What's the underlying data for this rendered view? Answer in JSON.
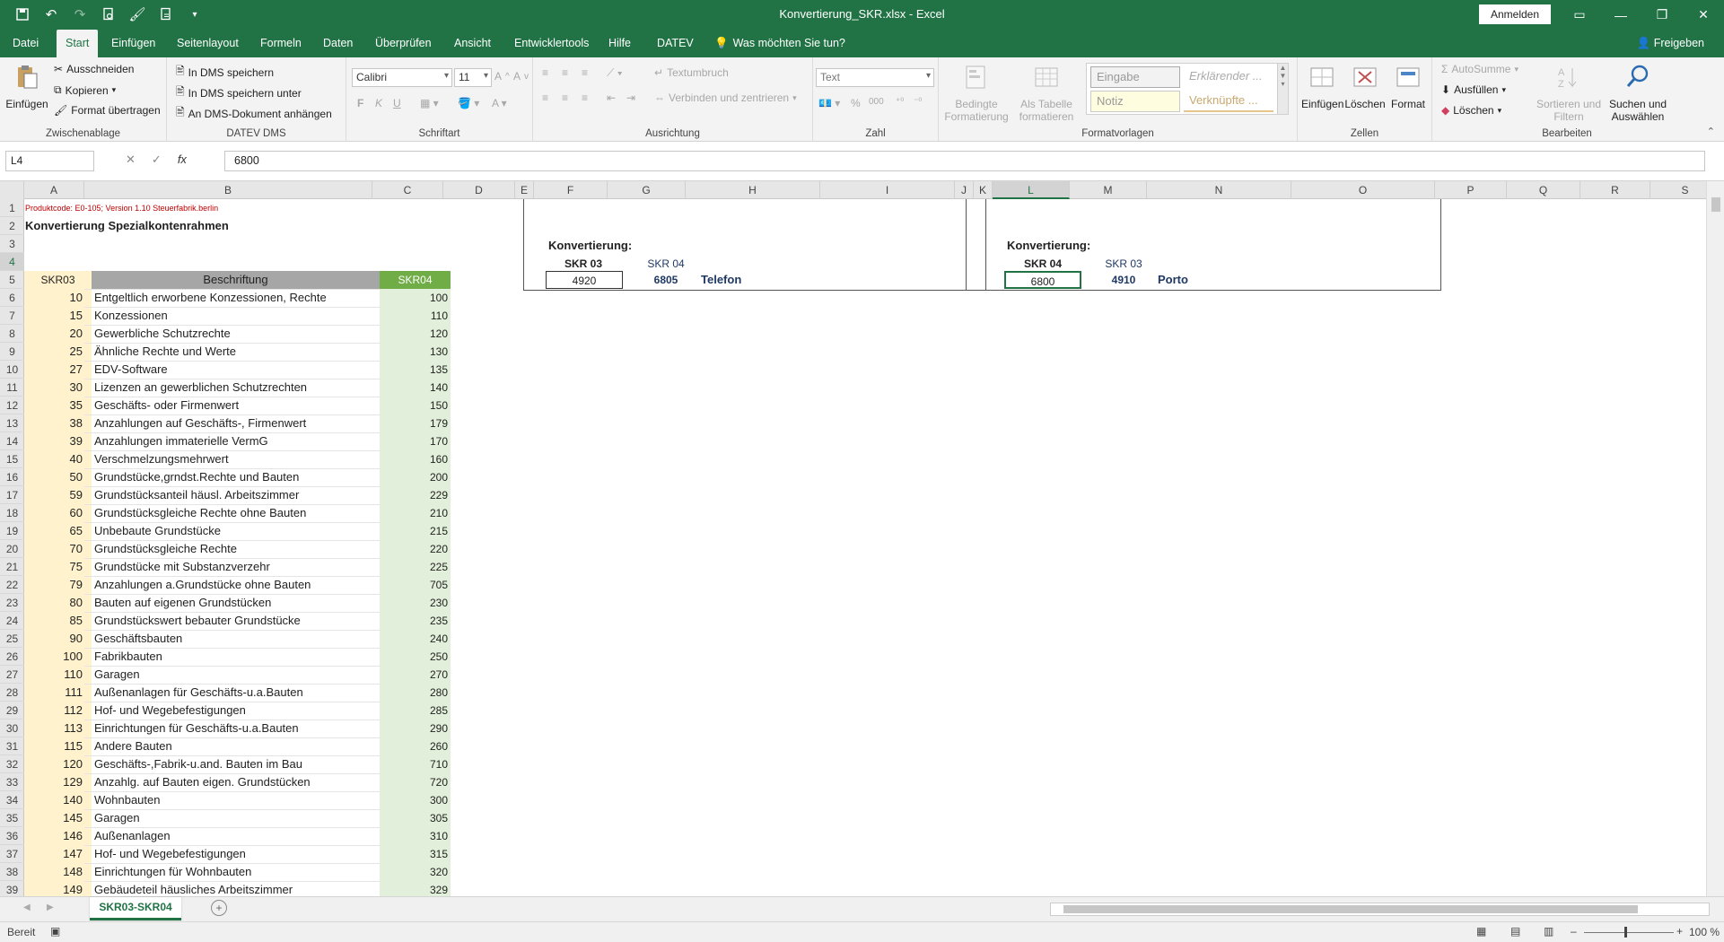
{
  "window": {
    "title": "Konvertierung_SKR.xlsx  -  Excel",
    "signin_label": "Anmelden",
    "share_label": "Freigeben"
  },
  "tabs": [
    "Datei",
    "Start",
    "Einfügen",
    "Seitenlayout",
    "Formeln",
    "Daten",
    "Überprüfen",
    "Ansicht",
    "Entwicklertools",
    "Hilfe",
    "DATEV"
  ],
  "tell_me": "Was möchten Sie tun?",
  "ribbon": {
    "clipboard": {
      "paste": "Einfügen",
      "cut": "Ausschneiden",
      "copy": "Kopieren",
      "format_painter": "Format übertragen",
      "label": "Zwischenablage"
    },
    "datev": {
      "save": "In DMS speichern",
      "save_as": "In DMS speichern unter",
      "attach": "An DMS-Dokument anhängen",
      "label": "DATEV DMS"
    },
    "font": {
      "name": "Calibri",
      "size": "11",
      "bold": "F",
      "italic": "K",
      "underline": "U",
      "label": "Schriftart"
    },
    "alignment": {
      "wrap": "Textumbruch",
      "merge": "Verbinden und zentrieren",
      "label": "Ausrichtung"
    },
    "number": {
      "format": "Text",
      "label": "Zahl"
    },
    "styles": {
      "cond_line1": "Bedingte",
      "cond_line2": "Formatierung",
      "table_line1": "Als Tabelle",
      "table_line2": "formatieren",
      "s1": "Eingabe",
      "s2": "Erklärender ...",
      "s3": "Notiz",
      "s4": "Verknüpfte ...",
      "label": "Formatvorlagen"
    },
    "cells": {
      "insert": "Einfügen",
      "delete": "Löschen",
      "format": "Format",
      "label": "Zellen"
    },
    "editing": {
      "autosum": "AutoSumme",
      "fill": "Ausfüllen",
      "clear": "Löschen",
      "sort_line1": "Sortieren und",
      "sort_line2": "Filtern",
      "find_line1": "Suchen und",
      "find_line2": "Auswählen",
      "label": "Bearbeiten"
    }
  },
  "formula_bar": {
    "name_box": "L4",
    "fx": "fx",
    "formula": "6800"
  },
  "columns": [
    "A",
    "B",
    "C",
    "D",
    "E",
    "F",
    "G",
    "H",
    "I",
    "J",
    "K",
    "L",
    "M",
    "N",
    "O",
    "P",
    "Q",
    "R",
    "S"
  ],
  "selected_column": "L",
  "selected_row": "4",
  "sheet": {
    "product_code": "Produktcode: E0-105; Version 1.10 Steuerfabrik.berlin",
    "title": "Konvertierung Spezialkontenrahmen",
    "headers": {
      "a": "SKR03",
      "b": "Beschriftung",
      "c": "SKR04"
    },
    "conv1": {
      "title": "Konvertierung:",
      "from_label": "SKR 03",
      "to_label": "SKR 04",
      "input": "4920",
      "result": "6805",
      "name": "Telefon"
    },
    "conv2": {
      "title": "Konvertierung:",
      "from_label": "SKR 04",
      "to_label": "SKR 03",
      "input": "6800",
      "result": "4910",
      "name": "Porto"
    },
    "rows": [
      {
        "skr03": "10",
        "text": "Entgeltlich erworbene Konzessionen, Rechte",
        "skr04": "100"
      },
      {
        "skr03": "15",
        "text": "Konzessionen",
        "skr04": "110"
      },
      {
        "skr03": "20",
        "text": "Gewerbliche Schutzrechte",
        "skr04": "120"
      },
      {
        "skr03": "25",
        "text": "Ähnliche Rechte und Werte",
        "skr04": "130"
      },
      {
        "skr03": "27",
        "text": "EDV-Software",
        "skr04": "135"
      },
      {
        "skr03": "30",
        "text": "Lizenzen an gewerblichen Schutzrechten",
        "skr04": "140"
      },
      {
        "skr03": "35",
        "text": "Geschäfts- oder Firmenwert",
        "skr04": "150"
      },
      {
        "skr03": "38",
        "text": "Anzahlungen auf Geschäfts-, Firmenwert",
        "skr04": "179"
      },
      {
        "skr03": "39",
        "text": "Anzahlungen immaterielle VermG",
        "skr04": "170"
      },
      {
        "skr03": "40",
        "text": "Verschmelzungsmehrwert",
        "skr04": "160"
      },
      {
        "skr03": "50",
        "text": "Grundstücke,grndst.Rechte und Bauten",
        "skr04": "200"
      },
      {
        "skr03": "59",
        "text": "Grundstücksanteil häusl. Arbeitszimmer",
        "skr04": "229"
      },
      {
        "skr03": "60",
        "text": "Grundstücksgleiche Rechte ohne Bauten",
        "skr04": "210"
      },
      {
        "skr03": "65",
        "text": "Unbebaute Grundstücke",
        "skr04": "215"
      },
      {
        "skr03": "70",
        "text": "Grundstücksgleiche Rechte",
        "skr04": "220"
      },
      {
        "skr03": "75",
        "text": "Grundstücke mit Substanzverzehr",
        "skr04": "225"
      },
      {
        "skr03": "79",
        "text": "Anzahlungen a.Grundstücke ohne Bauten",
        "skr04": "705"
      },
      {
        "skr03": "80",
        "text": "Bauten auf eigenen Grundstücken",
        "skr04": "230"
      },
      {
        "skr03": "85",
        "text": "Grundstückswert bebauter Grundstücke",
        "skr04": "235"
      },
      {
        "skr03": "90",
        "text": "Geschäftsbauten",
        "skr04": "240"
      },
      {
        "skr03": "100",
        "text": "Fabrikbauten",
        "skr04": "250"
      },
      {
        "skr03": "110",
        "text": "Garagen",
        "skr04": "270"
      },
      {
        "skr03": "111",
        "text": "Außenanlagen für Geschäfts-u.a.Bauten",
        "skr04": "280"
      },
      {
        "skr03": "112",
        "text": "Hof- und Wegebefestigungen",
        "skr04": "285"
      },
      {
        "skr03": "113",
        "text": "Einrichtungen für Geschäfts-u.a.Bauten",
        "skr04": "290"
      },
      {
        "skr03": "115",
        "text": "Andere Bauten",
        "skr04": "260"
      },
      {
        "skr03": "120",
        "text": "Geschäfts-,Fabrik-u.and. Bauten im Bau",
        "skr04": "710"
      },
      {
        "skr03": "129",
        "text": "Anzahlg. auf Bauten eigen. Grundstücken",
        "skr04": "720"
      },
      {
        "skr03": "140",
        "text": "Wohnbauten",
        "skr04": "300"
      },
      {
        "skr03": "145",
        "text": "Garagen",
        "skr04": "305"
      },
      {
        "skr03": "146",
        "text": "Außenanlagen",
        "skr04": "310"
      },
      {
        "skr03": "147",
        "text": "Hof- und Wegebefestigungen",
        "skr04": "315"
      },
      {
        "skr03": "148",
        "text": "Einrichtungen für Wohnbauten",
        "skr04": "320"
      },
      {
        "skr03": "149",
        "text": "Gebäudeteil häusliches Arbeitszimmer",
        "skr04": "329"
      }
    ]
  },
  "sheet_tab": "SKR03-SKR04",
  "status": {
    "ready": "Bereit",
    "zoom": "100 %"
  },
  "colors": {
    "excel_green": "#217346",
    "skr03_fill": "#fff2cc",
    "header_gray": "#a6a6a6",
    "skr04_fill": "#e2efda",
    "skr04_header": "#70ad47",
    "accent_red": "#c00000",
    "accent_blue": "#1f3864"
  }
}
